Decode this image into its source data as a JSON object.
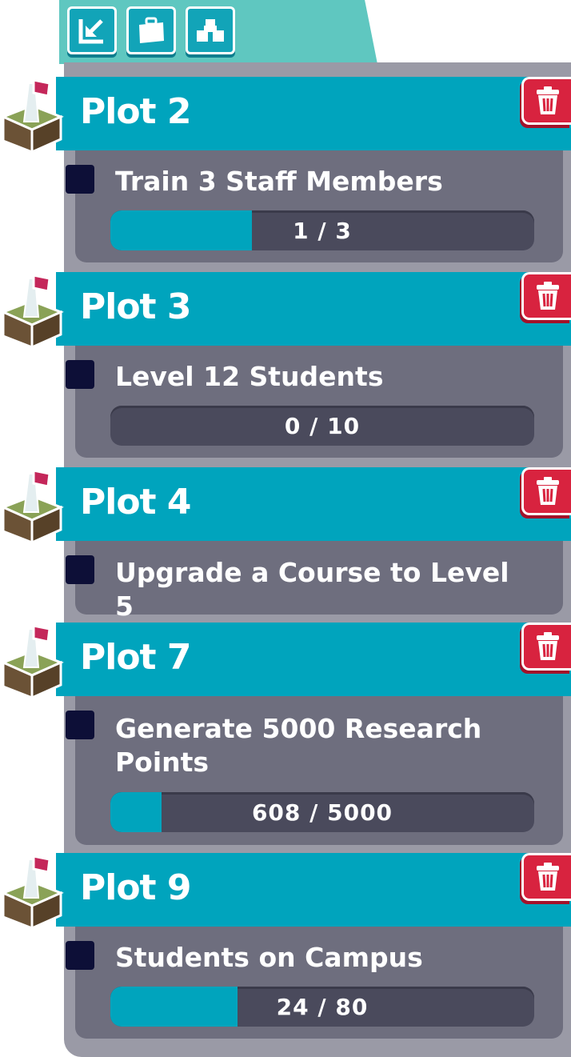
{
  "tabs": [
    {
      "icon": "import-arrow-icon"
    },
    {
      "icon": "briefcase-icon"
    },
    {
      "icon": "buildings-icon"
    }
  ],
  "plots": [
    {
      "title": "Plot 2",
      "goal": "Train 3 Staff Members",
      "progress_text": "1 / 3",
      "current": 1,
      "target": 3
    },
    {
      "title": "Plot 3",
      "goal": "Level 12 Students",
      "progress_text": "0 / 10",
      "current": 0,
      "target": 10
    },
    {
      "title": "Plot 4",
      "goal": "Upgrade a Course to Level 5"
    },
    {
      "title": "Plot 7",
      "goal": "Generate 5000 Research Points",
      "progress_text": "608 / 5000",
      "current": 608,
      "target": 5000
    },
    {
      "title": "Plot 9",
      "goal": "Students on Campus",
      "progress_text": "24 / 80",
      "current": 24,
      "target": 80
    }
  ],
  "colors": {
    "accent": "#00a4bd",
    "tab_bar": "#5fc7c0",
    "panel": "#9a9aa6",
    "card": "#6e6e7e",
    "trash": "#d8233f",
    "checkbox": "#0d0f37"
  }
}
